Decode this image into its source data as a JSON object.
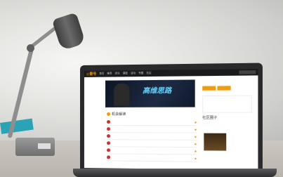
{
  "scene": {
    "description_labels": {
      "desk_lamp": "desk-lamp",
      "laptop": "laptop",
      "website": "website-on-screen"
    }
  },
  "colors": {
    "accent": "#f29b11",
    "screen_nav": "#1b1b1d",
    "teal_object": "#29a3b5"
  },
  "website": {
    "logo": "◎壹号",
    "nav_items": [
      "首页",
      "推荐",
      "资讯",
      "课程",
      "活动",
      "专题",
      "社区"
    ],
    "banner_text": "高维思路",
    "section_title": "机会解读",
    "side_title": "社区圈子"
  }
}
